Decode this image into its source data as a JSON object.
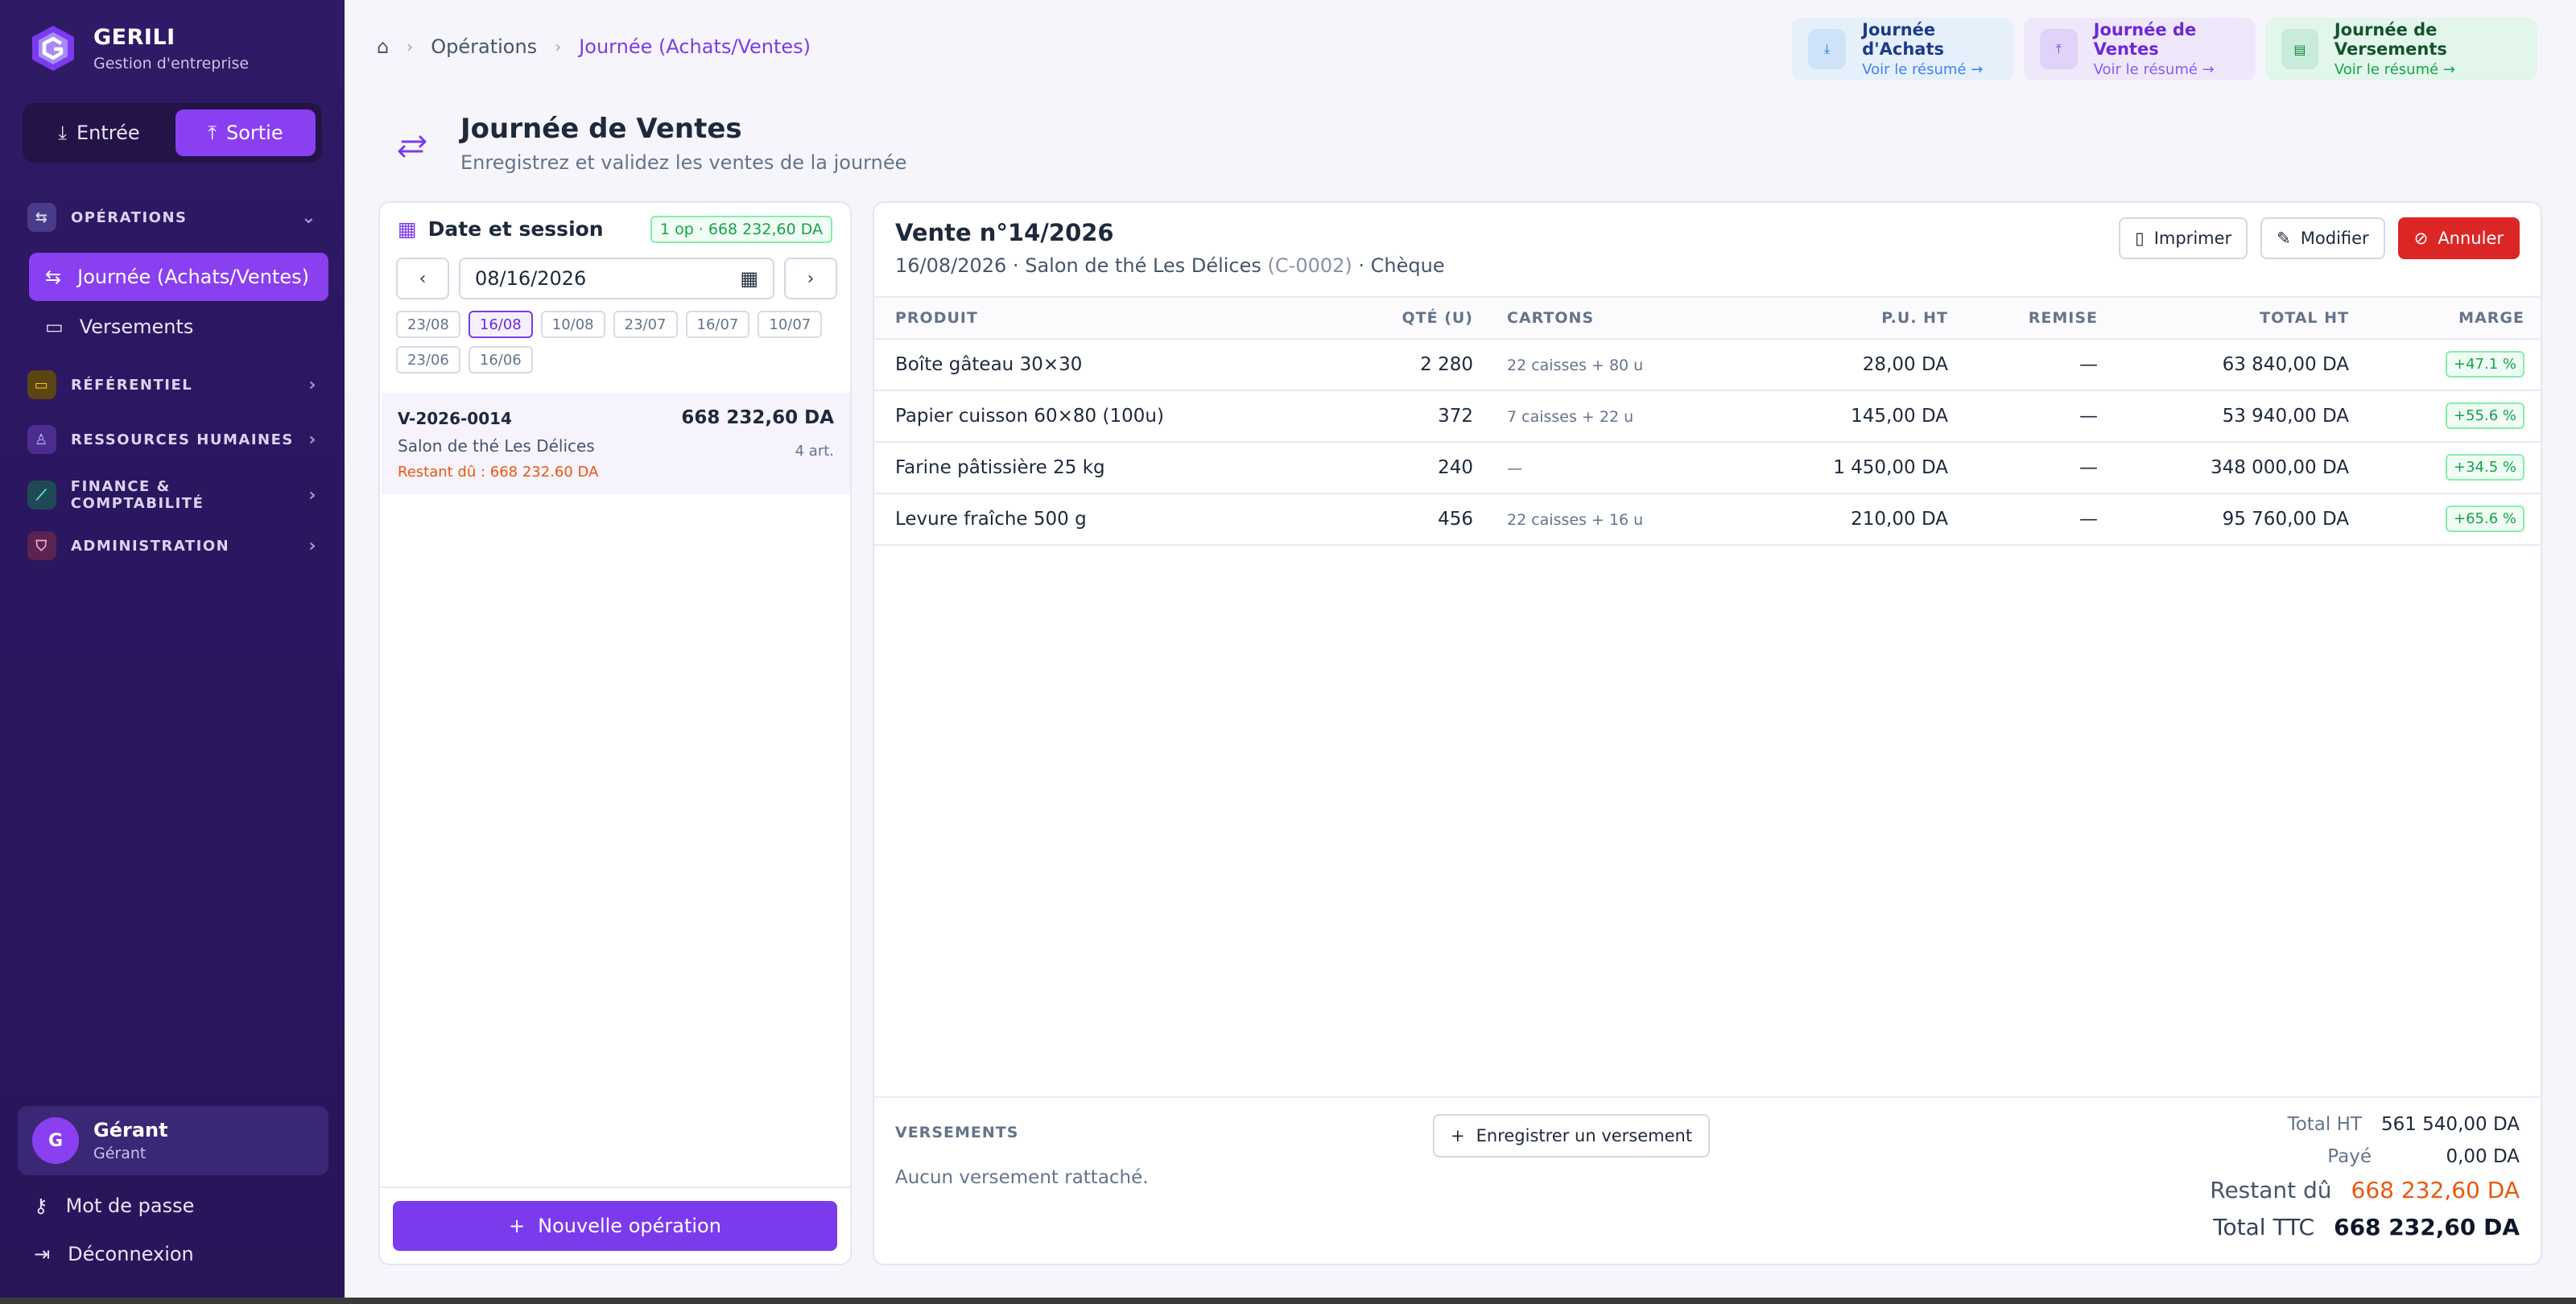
{
  "app": {
    "name": "GERILI",
    "subtitle": "Gestion d'entreprise"
  },
  "mode": {
    "entree": "Entrée",
    "sortie": "Sortie"
  },
  "sidebar": {
    "sections": [
      {
        "label": "OPÉRATIONS",
        "icon": "arrows-icon",
        "color": "#5b4a9e"
      },
      {
        "label": "RÉFÉRENTIEL",
        "icon": "folder-icon",
        "color": "#a16207"
      },
      {
        "label": "RESSOURCES HUMAINES",
        "icon": "user-icon",
        "color": "#6d28d9"
      },
      {
        "label": "FINANCE & COMPTABILITÉ",
        "icon": "chart-icon",
        "color": "#0f766e"
      },
      {
        "label": "ADMINISTRATION",
        "icon": "shield-icon",
        "color": "#be185d"
      }
    ],
    "items": [
      {
        "label": "Journée (Achats/Ventes)",
        "active": true
      },
      {
        "label": "Versements",
        "active": false
      }
    ],
    "user": {
      "initial": "G",
      "name": "Gérant",
      "role": "Gérant"
    },
    "password_link": "Mot de passe",
    "logout_link": "Déconnexion"
  },
  "breadcrumb": {
    "parent": "Opérations",
    "current": "Journée (Achats/Ventes)"
  },
  "quick_links": [
    {
      "title": "Journée d'Achats",
      "sub": "Voir le résumé →",
      "icon": "download-icon"
    },
    {
      "title": "Journée de Ventes",
      "sub": "Voir le résumé →",
      "icon": "upload-icon"
    },
    {
      "title": "Journée de Versements",
      "sub": "Voir le résumé →",
      "icon": "receipt-icon"
    }
  ],
  "page": {
    "title": "Journée de Ventes",
    "subtitle": "Enregistrez et validez les ventes de la journée"
  },
  "session": {
    "title": "Date et session",
    "badge": "1 op · 668 232,60 DA",
    "date_value": "08/16/2026",
    "chips": [
      "23/08",
      "16/08",
      "10/08",
      "23/07",
      "16/07",
      "10/07",
      "23/06",
      "16/06"
    ],
    "active_chip": "16/08",
    "operation": {
      "id": "V-2026-0014",
      "amount": "668 232,60 DA",
      "client": "Salon de thé Les Délices",
      "articles": "4 art.",
      "due": "Restant dû : 668 232.60 DA"
    },
    "new_button": "Nouvelle opération"
  },
  "sale": {
    "title": "Vente n°14/2026",
    "date": "16/08/2026",
    "client": "Salon de thé Les Délices",
    "client_code": "(C-0002)",
    "payment": "Chèque",
    "actions": {
      "print": "Imprimer",
      "edit": "Modifier",
      "cancel": "Annuler"
    },
    "columns": [
      "PRODUIT",
      "QTÉ (U)",
      "CARTONS",
      "P.U. HT",
      "REMISE",
      "TOTAL HT",
      "MARGE"
    ],
    "rows": [
      {
        "produit": "Boîte gâteau 30×30",
        "qte": "2 280",
        "cartons": "22 caisses + 80 u",
        "pu": "28,00 DA",
        "remise": "—",
        "total": "63 840,00 DA",
        "marge": "+47.1 %"
      },
      {
        "produit": "Papier cuisson 60×80 (100u)",
        "qte": "372",
        "cartons": "7 caisses + 22 u",
        "pu": "145,00 DA",
        "remise": "—",
        "total": "53 940,00 DA",
        "marge": "+55.6 %"
      },
      {
        "produit": "Farine pâtissière 25 kg",
        "qte": "240",
        "cartons": "—",
        "pu": "1 450,00 DA",
        "remise": "—",
        "total": "348 000,00 DA",
        "marge": "+34.5 %"
      },
      {
        "produit": "Levure fraîche 500 g",
        "qte": "456",
        "cartons": "22 caisses + 16 u",
        "pu": "210,00 DA",
        "remise": "—",
        "total": "95 760,00 DA",
        "marge": "+65.6 %"
      }
    ],
    "versements": {
      "label": "VERSEMENTS",
      "empty": "Aucun versement rattaché.",
      "add_button": "Enregistrer un versement"
    },
    "totals": {
      "ht_label": "Total HT",
      "ht": "561 540,00 DA",
      "paye_label": "Payé",
      "paye": "0,00 DA",
      "restant_label": "Restant dû",
      "restant": "668 232,60 DA",
      "ttc_label": "Total TTC",
      "ttc": "668 232,60 DA"
    }
  }
}
